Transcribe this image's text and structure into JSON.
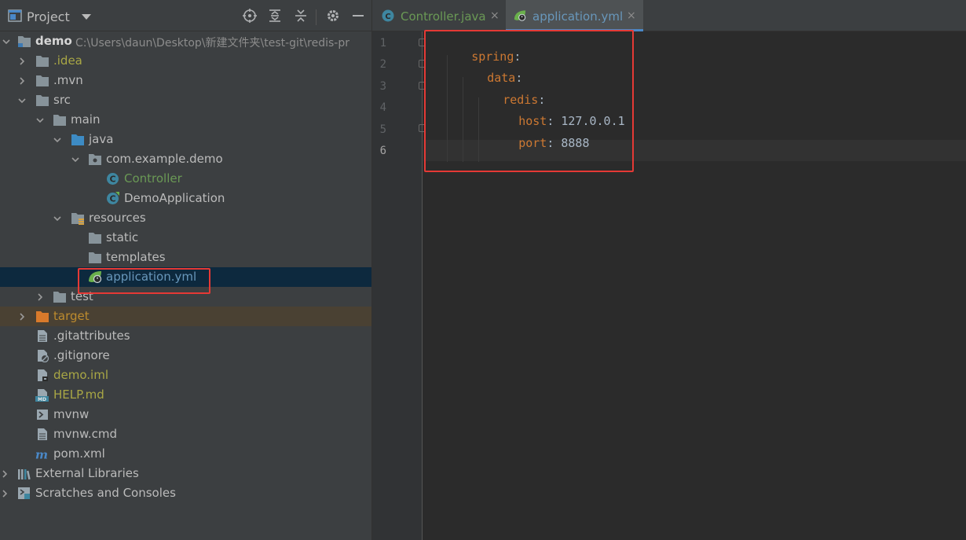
{
  "project_panel": {
    "title": "Project",
    "toolbar_icons": [
      "locate-icon",
      "expand-all-icon",
      "collapse-all-icon",
      "gear-icon",
      "hide-icon"
    ]
  },
  "tree": {
    "root": {
      "name": "demo",
      "path": "C:\\Users\\daun\\Desktop\\新建文件夹\\test-git\\redis-pr"
    },
    "items": [
      {
        "label": ".idea"
      },
      {
        "label": ".mvn"
      },
      {
        "label": "src"
      },
      {
        "label": "main"
      },
      {
        "label": "java"
      },
      {
        "label": "com.example.demo"
      },
      {
        "label": "Controller"
      },
      {
        "label": "DemoApplication"
      },
      {
        "label": "resources"
      },
      {
        "label": "static"
      },
      {
        "label": "templates"
      },
      {
        "label": "application.yml"
      },
      {
        "label": "test"
      },
      {
        "label": "target"
      },
      {
        "label": ".gitattributes"
      },
      {
        "label": ".gitignore"
      },
      {
        "label": "demo.iml"
      },
      {
        "label": "HELP.md"
      },
      {
        "label": "mvnw"
      },
      {
        "label": "mvnw.cmd"
      },
      {
        "label": "pom.xml"
      },
      {
        "label": "External Libraries"
      },
      {
        "label": "Scratches and Consoles"
      }
    ]
  },
  "tabs": [
    {
      "label": "Controller.java",
      "close": "×",
      "icon": "java-class-icon"
    },
    {
      "label": "application.yml",
      "close": "×",
      "icon": "spring-yaml-icon",
      "active": true
    }
  ],
  "editor": {
    "line_numbers": [
      "1",
      "2",
      "3",
      "4",
      "5",
      "6"
    ],
    "lines": [
      {
        "key": "spring",
        "colon": ":",
        "value": ""
      },
      {
        "key": "data",
        "colon": ":",
        "value": ""
      },
      {
        "key": "redis",
        "colon": ":",
        "value": ""
      },
      {
        "key": "host",
        "colon": ":",
        "value": " 127.0.0.1"
      },
      {
        "key": "port",
        "colon": ":",
        "value": " 8888"
      },
      {
        "key": "",
        "colon": "",
        "value": ""
      }
    ]
  },
  "colors": {
    "panel_bg": "#3c3f41",
    "editor_bg": "#2b2b2b",
    "selection": "#0d293e",
    "yaml_key": "#cc7832",
    "highlight_box": "#e53935"
  }
}
